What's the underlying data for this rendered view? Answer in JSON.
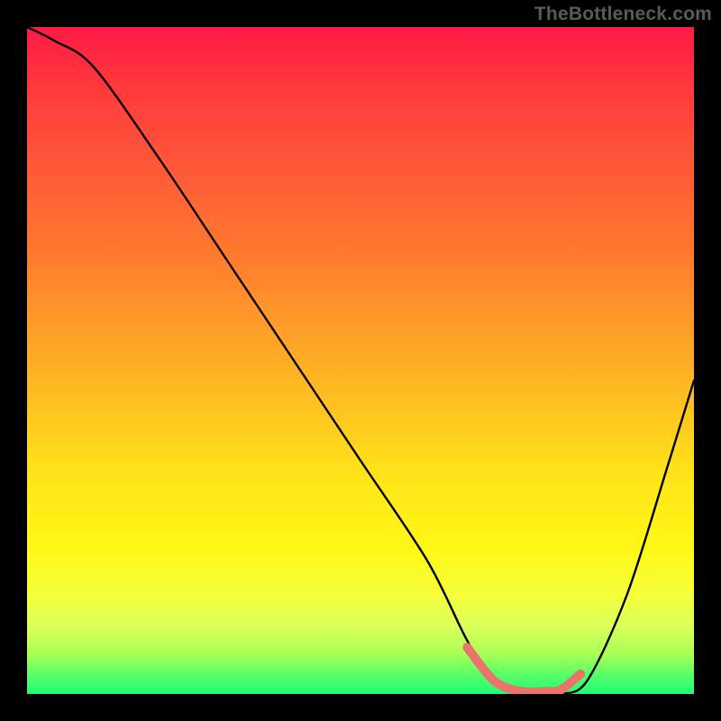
{
  "watermark": "TheBottleneck.com",
  "chart_data": {
    "type": "line",
    "title": "",
    "xlabel": "",
    "ylabel": "",
    "xlim": [
      0,
      100
    ],
    "ylim": [
      0,
      100
    ],
    "series": [
      {
        "name": "curve",
        "x": [
          0,
          4,
          10,
          20,
          30,
          40,
          50,
          60,
          66,
          70,
          74,
          78,
          80,
          84,
          90,
          96,
          100
        ],
        "values": [
          100,
          98,
          94,
          80,
          65,
          50,
          35,
          20,
          8,
          2,
          0,
          0,
          0,
          2,
          15,
          34,
          47
        ]
      }
    ],
    "highlight": {
      "name": "trough-marker",
      "x": [
        66,
        70,
        74,
        78,
        80,
        83
      ],
      "values": [
        7,
        2,
        0.4,
        0.4,
        0.6,
        3
      ],
      "color": "#e8746b"
    },
    "gradient_stops": [
      {
        "pct": 0,
        "color": "#ff1a44"
      },
      {
        "pct": 50,
        "color": "#ffc61f"
      },
      {
        "pct": 85,
        "color": "#f6ff3a"
      },
      {
        "pct": 100,
        "color": "#1cff74"
      }
    ]
  }
}
